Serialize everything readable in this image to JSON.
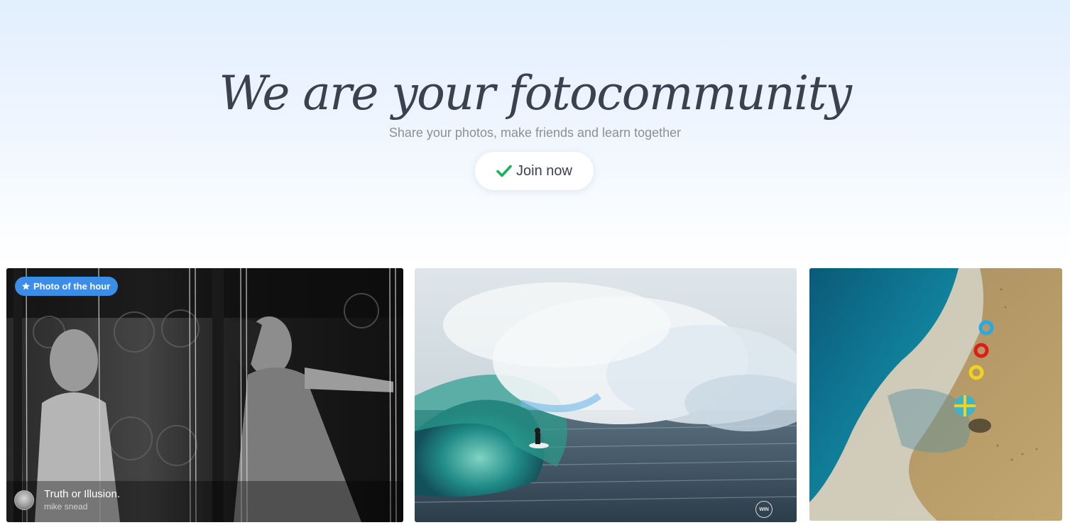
{
  "hero": {
    "title": "We are your fotocommunity",
    "subtitle": "Share your photos, make friends and learn together",
    "join_label": "Join now",
    "accent_check_color": "#18b35c"
  },
  "photos": [
    {
      "badge_label": "Photo of the hour",
      "badge_icon": "star-icon",
      "badge_color": "#3b8de8",
      "title": "Truth or Illusion.",
      "author": "mike snead"
    },
    {
      "watermark": "WIN"
    },
    {}
  ]
}
